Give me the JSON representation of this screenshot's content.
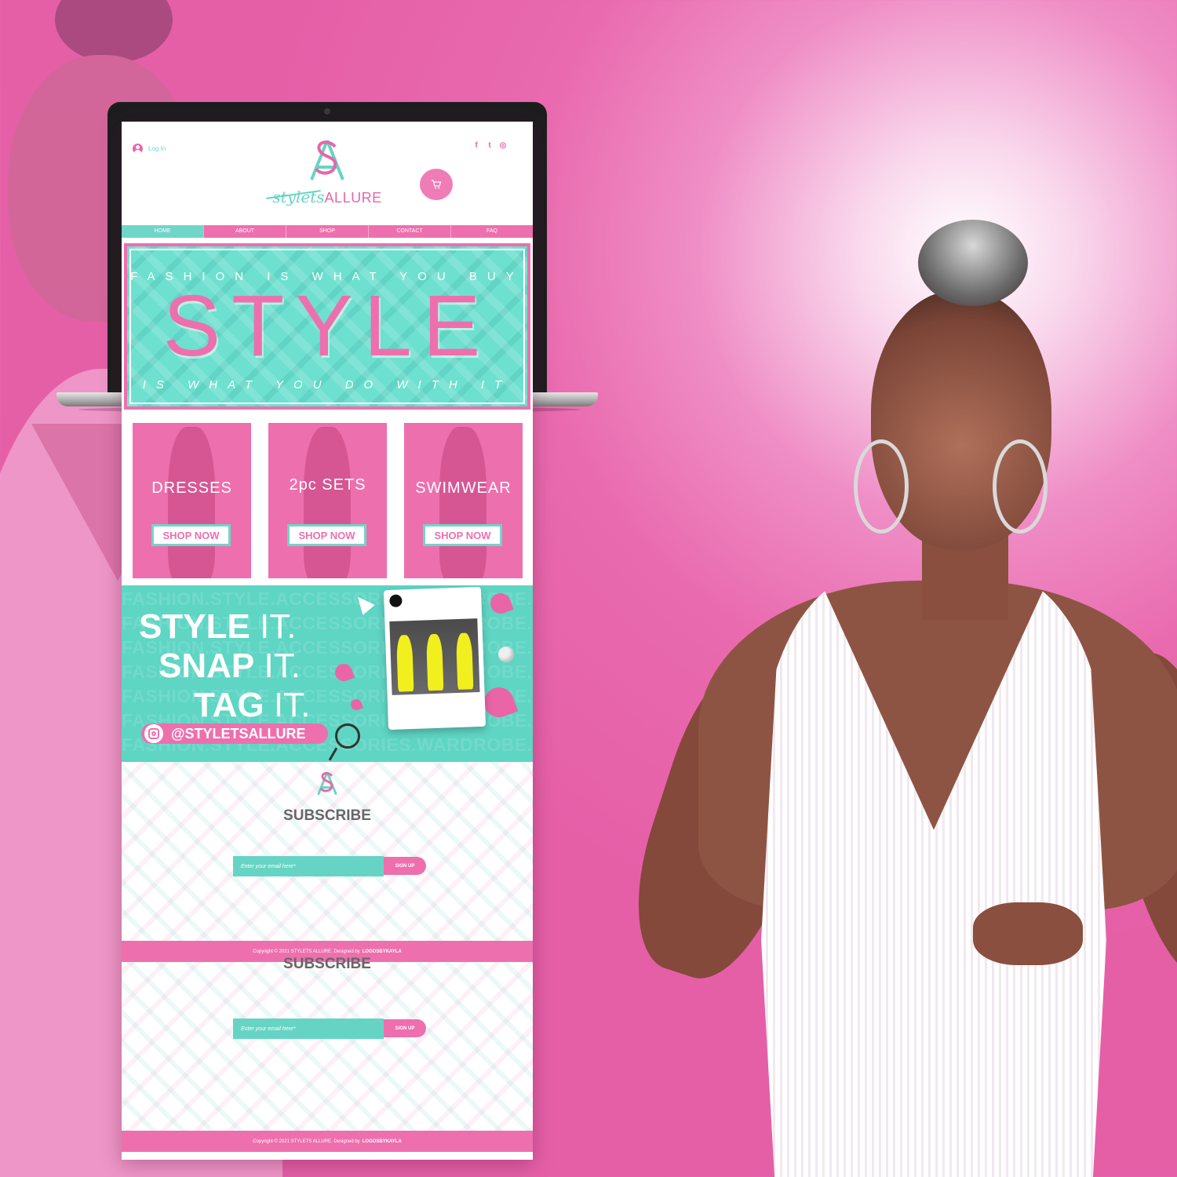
{
  "site": {
    "login_label": "Log In",
    "social_icons": [
      "facebook-icon",
      "twitter-icon",
      "instagram-icon"
    ],
    "logo": {
      "monogram": "SA",
      "script": "stylets",
      "caps": "ALLURE"
    },
    "nav": [
      "HOME",
      "ABOUT",
      "SHOP",
      "CONTACT",
      "FAQ"
    ],
    "hero": {
      "line1": "FASHION IS WHAT YOU BUY",
      "big": "STYLE",
      "line2": "IS WHAT YOU DO WITH IT"
    },
    "categories": [
      {
        "label": "DRESSES",
        "button": "SHOP NOW"
      },
      {
        "label": "2pc SETS",
        "button": "SHOP NOW"
      },
      {
        "label": "SWIMWEAR",
        "button": "SHOP NOW"
      }
    ],
    "instagram": {
      "watermark": "FASHION.STYLE.ACCESSORIES.WARDROBE.",
      "rows": [
        {
          "bold": "STYLE",
          "thin": "IT."
        },
        {
          "bold": "SNAP",
          "thin": "IT."
        },
        {
          "bold": "TAG",
          "thin": "IT."
        }
      ],
      "handle": "@STYLETSALLURE"
    },
    "subscribe": {
      "title": "SUBSCRIBE",
      "email_placeholder": "Enter your email here*",
      "signup_label": "SIGN UP"
    },
    "footer": {
      "copyright": "Copyright © 2021 STYLETS ALLURE. Designed by",
      "designer": "LOGOSBYKAYLA"
    }
  },
  "colors": {
    "pink": "#ee6fae",
    "teal": "#6fd6c8",
    "background": "#e96aae"
  }
}
